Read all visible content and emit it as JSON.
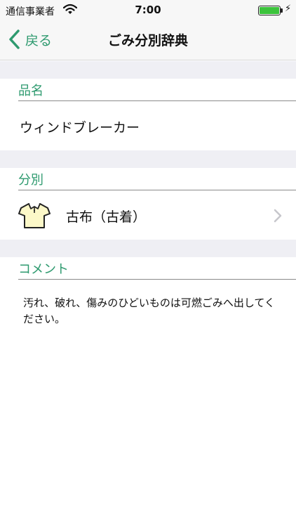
{
  "status_bar": {
    "carrier": "通信事業者",
    "time": "7:00"
  },
  "nav": {
    "back_label": "戻る",
    "title": "ごみ分別辞典"
  },
  "sections": {
    "item_name": {
      "header": "品名",
      "value": "ウィンドブレーカー"
    },
    "category": {
      "header": "分別",
      "value": "古布（古着）",
      "icon": "shirt-icon"
    },
    "comment": {
      "header": "コメント",
      "text": "汚れ、破れ、傷みのひどいものは可燃ごみへ出してください。"
    }
  },
  "colors": {
    "accent": "#2e9a6f",
    "battery": "#3cc33c",
    "gap": "#efeff4"
  }
}
